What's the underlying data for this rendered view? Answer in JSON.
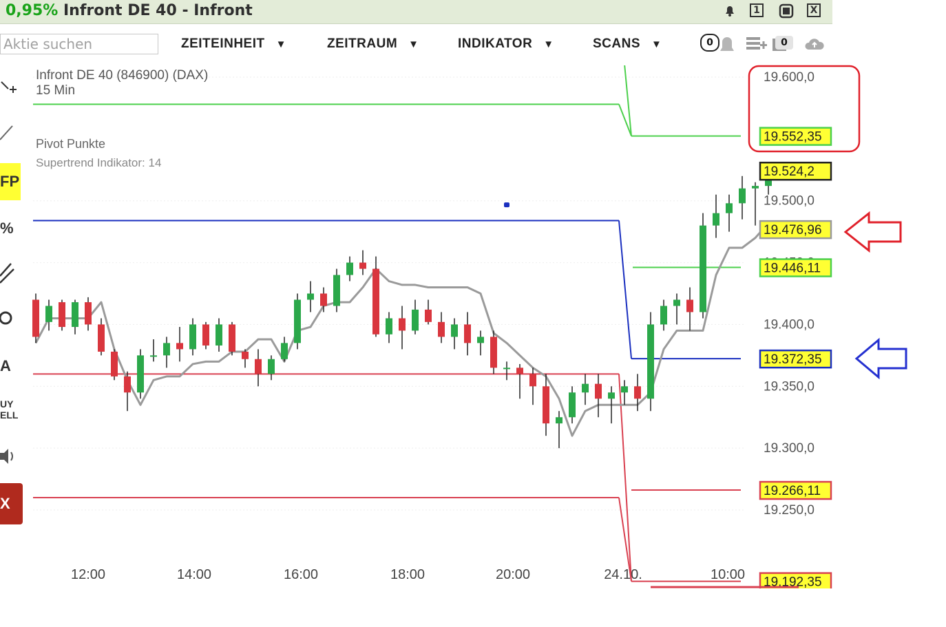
{
  "window": {
    "change_pct": "0,95%",
    "title": "Infront DE 40 - Infront",
    "btn_minimize": "1",
    "btn_close": "X"
  },
  "toolbar": {
    "search_placeholder": "Aktie suchen",
    "menus": [
      "ZEITEINHEIT",
      "ZEITRAUM",
      "INDIKATOR",
      "SCANS"
    ],
    "menu_arrow": "▼",
    "alert_count": "0",
    "watchlist_count": "0"
  },
  "sidebar": {
    "items": [
      "FP",
      "%",
      "A",
      "UY",
      "ELL",
      "X"
    ]
  },
  "chart": {
    "instrument": "Infront DE 40 (846900) (DAX)",
    "interval": "15 Min",
    "indicators": [
      "Pivot Punkte",
      "Supertrend Indikator: 14"
    ]
  },
  "colors": {
    "bull": "#2ba84a",
    "bear": "#d9363e",
    "pivot_green": "#4cd04c",
    "pivot_blue": "#1a2fbf",
    "pivot_red": "#d94050",
    "supertrend": "#9a9a9a",
    "label_yellow": "#ffff33",
    "annotation_red": "#e0202a",
    "annotation_blue": "#2430d0"
  },
  "chart_data": {
    "type": "candlestick",
    "x_ticks": [
      "12:00",
      "14:00",
      "16:00",
      "18:00",
      "20:00",
      "24.10.",
      "10:00"
    ],
    "y_ticks": [
      "19.600,0",
      "19.500,0",
      "19.450,0",
      "19.400,0",
      "19.350,0",
      "19.300,0",
      "19.250,0"
    ],
    "y_tick_values": [
      19600,
      19500,
      19450,
      19400,
      19350,
      19300,
      19250
    ],
    "ylim": [
      19180,
      19630
    ],
    "price_labels": [
      {
        "text": "19.552,35",
        "value": 19552.35,
        "color": "green"
      },
      {
        "text": "19.524,2",
        "value": 19524.2,
        "color": "black"
      },
      {
        "text": "19.476,96",
        "value": 19476.96,
        "color": "gray"
      },
      {
        "text": "19.446,11",
        "value": 19446.11,
        "color": "green"
      },
      {
        "text": "19.372,35",
        "value": 19372.35,
        "color": "blue"
      },
      {
        "text": "19.266,11",
        "value": 19266.11,
        "color": "red"
      },
      {
        "text": "19.192,35",
        "value": 19192.35,
        "color": "red"
      }
    ],
    "pivots_day1": [
      {
        "value": 19578,
        "color": "green"
      },
      {
        "value": 19484,
        "color": "blue"
      },
      {
        "value": 19360,
        "color": "red"
      },
      {
        "value": 19260,
        "color": "red"
      }
    ],
    "pivots_day2": [
      {
        "value": 19552.35,
        "color": "green"
      },
      {
        "value": 19446.11,
        "color": "green"
      },
      {
        "value": 19372.35,
        "color": "blue"
      },
      {
        "value": 19266.11,
        "color": "red"
      },
      {
        "value": 19192.35,
        "color": "red"
      }
    ],
    "day_break_index": 45,
    "candles": [
      [
        19420,
        19425,
        19385,
        19390
      ],
      [
        19402,
        19420,
        19395,
        19415
      ],
      [
        19418,
        19420,
        19395,
        19398
      ],
      [
        19398,
        19420,
        19392,
        19418
      ],
      [
        19418,
        19422,
        19395,
        19400
      ],
      [
        19400,
        19405,
        19375,
        19378
      ],
      [
        19378,
        19380,
        19355,
        19358
      ],
      [
        19358,
        19362,
        19330,
        19345
      ],
      [
        19345,
        19380,
        19340,
        19375
      ],
      [
        19375,
        19388,
        19370,
        19375
      ],
      [
        19375,
        19390,
        19365,
        19385
      ],
      [
        19385,
        19398,
        19370,
        19380
      ],
      [
        19380,
        19405,
        19375,
        19400
      ],
      [
        19400,
        19402,
        19380,
        19383
      ],
      [
        19383,
        19405,
        19378,
        19400
      ],
      [
        19400,
        19402,
        19375,
        19378
      ],
      [
        19378,
        19380,
        19365,
        19372
      ],
      [
        19372,
        19380,
        19350,
        19360
      ],
      [
        19360,
        19375,
        19355,
        19372
      ],
      [
        19372,
        19390,
        19370,
        19385
      ],
      [
        19385,
        19425,
        19380,
        19420
      ],
      [
        19420,
        19435,
        19410,
        19425
      ],
      [
        19425,
        19430,
        19410,
        19415
      ],
      [
        19415,
        19445,
        19410,
        19440
      ],
      [
        19440,
        19455,
        19435,
        19450
      ],
      [
        19450,
        19460,
        19440,
        19445
      ],
      [
        19445,
        19455,
        19390,
        19392
      ],
      [
        19392,
        19410,
        19385,
        19405
      ],
      [
        19405,
        19415,
        19380,
        19395
      ],
      [
        19395,
        19420,
        19392,
        19412
      ],
      [
        19412,
        19420,
        19400,
        19402
      ],
      [
        19402,
        19410,
        19385,
        19390
      ],
      [
        19390,
        19405,
        19380,
        19400
      ],
      [
        19400,
        19410,
        19375,
        19385
      ],
      [
        19385,
        19395,
        19375,
        19390
      ],
      [
        19390,
        19395,
        19360,
        19365
      ],
      [
        19365,
        19370,
        19355,
        19365
      ],
      [
        19365,
        19368,
        19340,
        19360
      ],
      [
        19360,
        19365,
        19335,
        19350
      ],
      [
        19350,
        19360,
        19310,
        19320
      ],
      [
        19320,
        19330,
        19300,
        19325
      ],
      [
        19325,
        19350,
        19320,
        19345
      ],
      [
        19345,
        19360,
        19335,
        19352
      ],
      [
        19352,
        19360,
        19325,
        19340
      ],
      [
        19340,
        19350,
        19320,
        19345
      ],
      [
        19345,
        19355,
        19335,
        19350
      ],
      [
        19350,
        19360,
        19330,
        19340
      ],
      [
        19340,
        19410,
        19330,
        19400
      ],
      [
        19400,
        19420,
        19395,
        19415
      ],
      [
        19415,
        19425,
        19400,
        19420
      ],
      [
        19420,
        19430,
        19395,
        19410
      ],
      [
        19410,
        19490,
        19405,
        19480
      ],
      [
        19480,
        19505,
        19470,
        19490
      ],
      [
        19490,
        19505,
        19475,
        19498
      ],
      [
        19498,
        19520,
        19485,
        19510
      ],
      [
        19510,
        19515,
        19480,
        19512
      ],
      [
        19512,
        19530,
        19505,
        19526
      ]
    ],
    "supertrend": [
      19385,
      19405,
      19405,
      19405,
      19405,
      19418,
      19380,
      19355,
      19335,
      19355,
      19358,
      19358,
      19368,
      19370,
      19370,
      19378,
      19378,
      19388,
      19388,
      19370,
      19395,
      19398,
      19415,
      19418,
      19418,
      19430,
      19445,
      19435,
      19432,
      19432,
      19430,
      19430,
      19430,
      19430,
      19425,
      19393,
      19385,
      19375,
      19365,
      19358,
      19340,
      19310,
      19330,
      19335,
      19335,
      19335,
      19335,
      19345,
      19380,
      19395,
      19395,
      19395,
      19440,
      19462,
      19462,
      19470,
      19482
    ],
    "dot": {
      "index": 36,
      "value": 19497
    }
  }
}
